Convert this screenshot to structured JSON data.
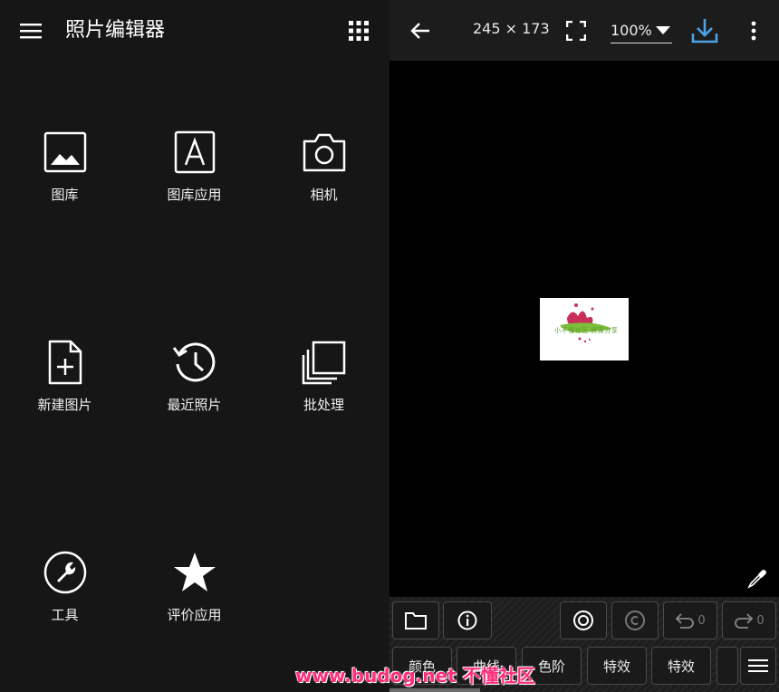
{
  "left": {
    "title": "照片编辑器",
    "tiles": [
      {
        "label": "图库",
        "icon": "gallery-icon"
      },
      {
        "label": "图库应用",
        "icon": "gallery-app-icon"
      },
      {
        "label": "相机",
        "icon": "camera-icon"
      },
      {
        "label": "新建图片",
        "icon": "new-image-icon"
      },
      {
        "label": "最近照片",
        "icon": "history-icon"
      },
      {
        "label": "批处理",
        "icon": "batch-icon"
      },
      {
        "label": "工具",
        "icon": "wrench-icon"
      },
      {
        "label": "评价应用",
        "icon": "star-icon"
      }
    ]
  },
  "right": {
    "dimensions": "245 × 173",
    "zoom": "100%",
    "thumbnail_caption": "小不懂社区 资源分享",
    "toolbar": {
      "row1": [
        {
          "name": "open-folder",
          "icon": "folder-icon",
          "label": ""
        },
        {
          "name": "info",
          "icon": "info-icon",
          "label": ""
        },
        {
          "name": "target",
          "icon": "target-icon",
          "label": ""
        },
        {
          "name": "copyright",
          "icon": "copyright-icon",
          "label": ""
        },
        {
          "name": "undo",
          "icon": "undo-icon",
          "label": "0"
        },
        {
          "name": "redo",
          "icon": "redo-icon",
          "label": "0"
        }
      ],
      "row2": [
        "颜色",
        "曲线",
        "色阶",
        "特效",
        "特效"
      ]
    }
  },
  "watermark": "www.budog.net 不懂社区",
  "colors": {
    "left_bg": "#161616",
    "topbar_right_bg": "#1c1c1c",
    "download_accent": "#4aa3e8",
    "watermark": "#ff2d7a"
  }
}
